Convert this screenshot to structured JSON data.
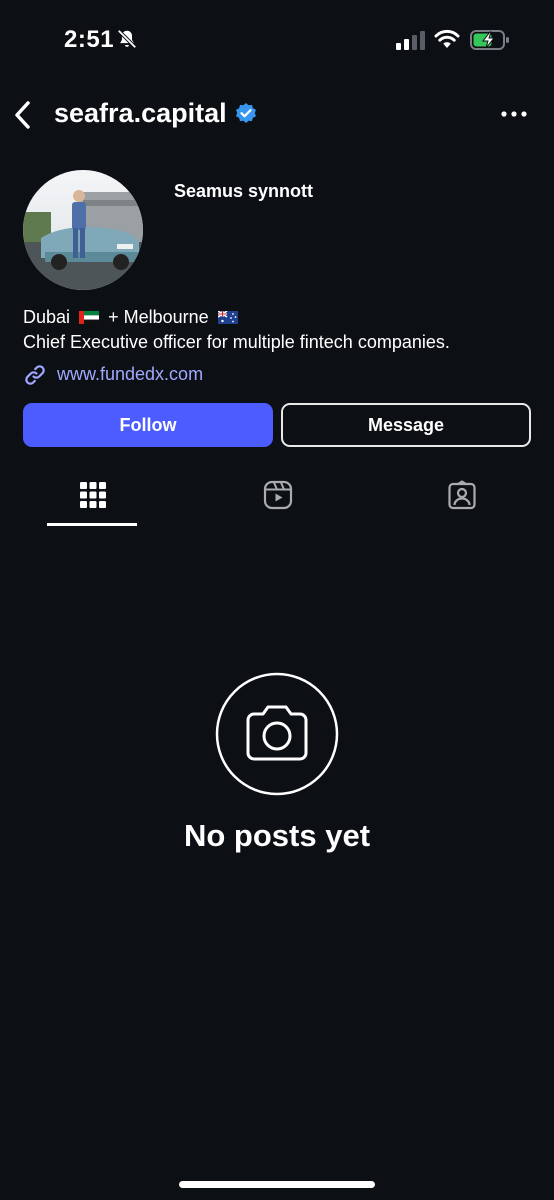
{
  "status_bar": {
    "time": "2:51",
    "icons": [
      "bell-slash-icon",
      "cellular-signal-icon",
      "wifi-icon",
      "battery-charging-icon"
    ]
  },
  "header": {
    "username": "seafra.capital",
    "verified": true,
    "icons": [
      "back-chevron-icon",
      "verified-badge-icon",
      "more-options-icon"
    ]
  },
  "profile": {
    "display_name": "Seamus synnott",
    "bio_city1": "Dubai",
    "bio_sep": "+ Melbourne",
    "bio_line2": "Chief Executive officer for multiple fintech companies.",
    "link": "www.fundedx.com"
  },
  "actions": {
    "follow_label": "Follow",
    "message_label": "Message"
  },
  "tabs": [
    {
      "name": "posts-grid",
      "icon": "grid-icon",
      "active": true
    },
    {
      "name": "reels",
      "icon": "reels-icon",
      "active": false
    },
    {
      "name": "tagged",
      "icon": "tagged-person-icon",
      "active": false
    }
  ],
  "empty_state": {
    "title": "No posts yet",
    "icon": "camera-icon"
  },
  "colors": {
    "background": "#0c0f14",
    "follow_button": "#4c5cff",
    "link": "#a0a9ff",
    "verified": "#3797f0"
  }
}
